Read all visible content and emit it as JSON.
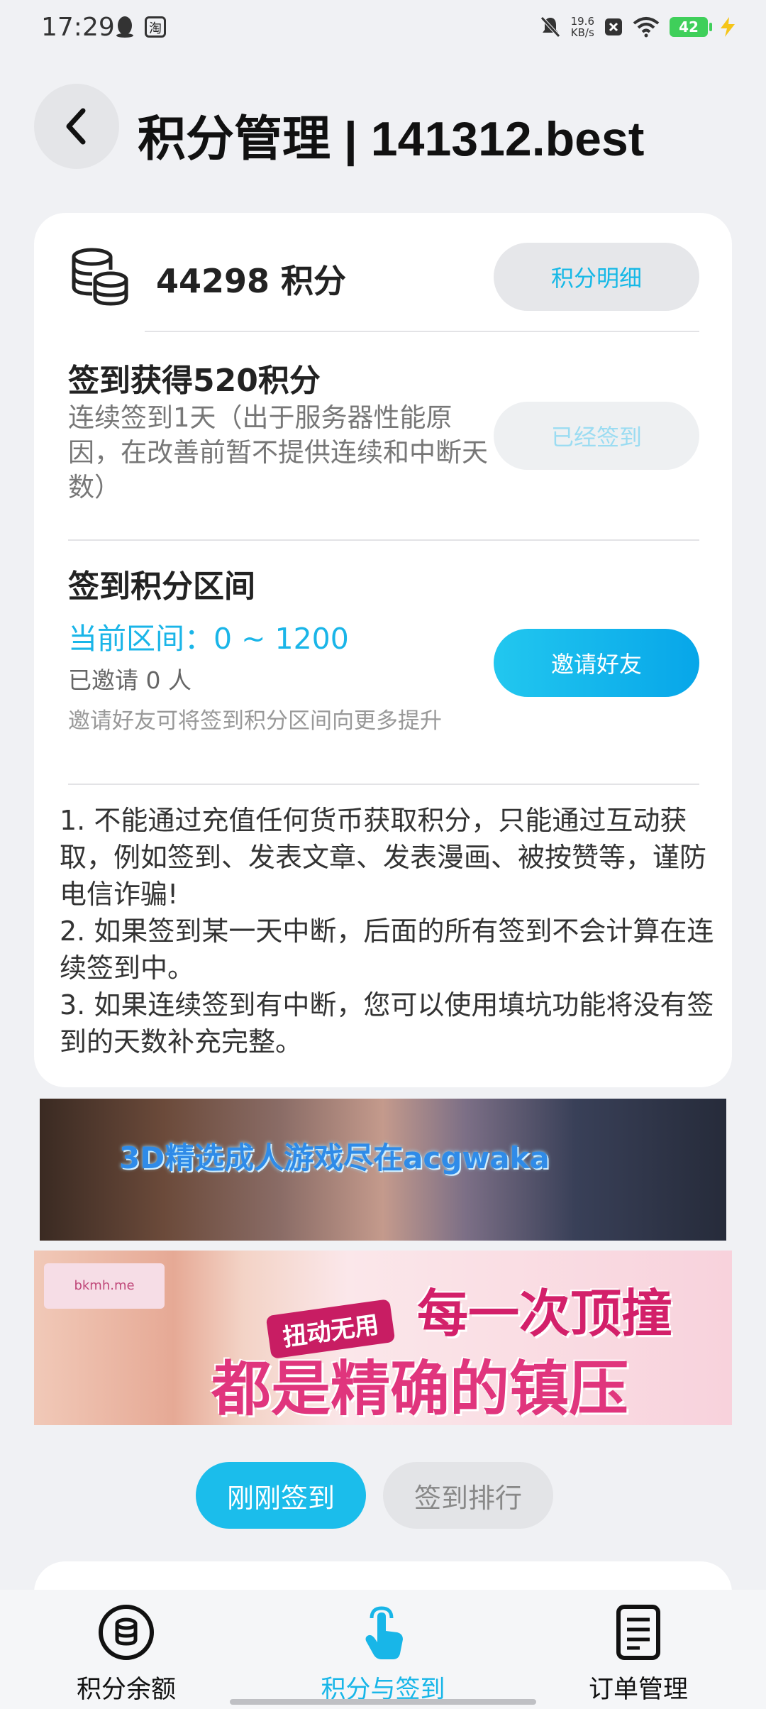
{
  "status_bar": {
    "time": "17:29",
    "app_icon_label": "淘",
    "net_speed_value": "19.6",
    "net_speed_unit": "KB/s",
    "battery": "42"
  },
  "header": {
    "title": "积分管理 | 141312.best"
  },
  "points": {
    "balance": "44298 积分",
    "detail_button": "积分明细"
  },
  "checkin": {
    "title": "签到获得520积分",
    "description": "连续签到1天（出于服务器性能原因，在改善前暂不提供连续和中断天数）",
    "button": "已经签到"
  },
  "range": {
    "title": "签到积分区间",
    "current": "当前区间：0 ~ 1200",
    "invited": "已邀请 0 人",
    "tip": "邀请好友可将签到积分区间向更多提升",
    "invite_button": "邀请好友"
  },
  "rules": [
    "1. 不能通过充值任何货币获取积分，只能通过互动获取，例如签到、发表文章、发表漫画、被按赞等，谨防电信诈骗!",
    "2. 如果签到某一天中断，后面的所有签到不会计算在连续签到中。",
    "3. 如果连续签到有中断，您可以使用填坑功能将没有签到的天数补充完整。"
  ],
  "banners": {
    "banner1_text": "3D精选成人游戏尽在acgwaka",
    "banner2_logo": "bkmh.me",
    "banner2_tag": "扭动无用",
    "banner2_line1": "每一次顶撞",
    "banner2_line2": "都是精确的镇压"
  },
  "tabs": {
    "recent": "刚刚签到",
    "ranking": "签到排行"
  },
  "bottom_nav": {
    "balance": "积分余额",
    "points_checkin": "积分与签到",
    "orders": "订单管理"
  },
  "colors": {
    "accent": "#1bbdeb",
    "background": "#f0f1f4"
  }
}
